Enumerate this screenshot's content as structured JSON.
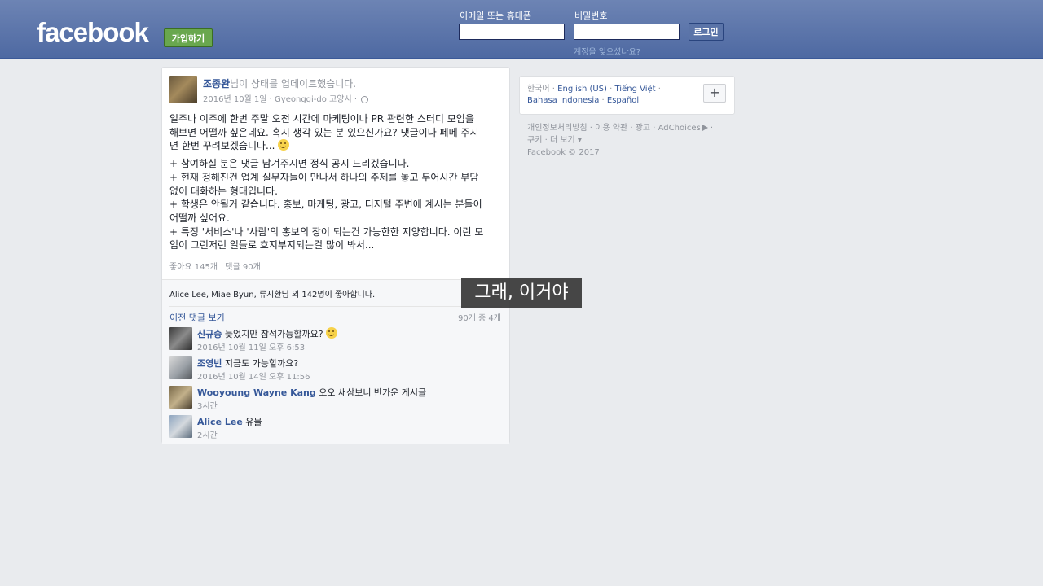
{
  "header": {
    "logo": "facebook",
    "signup_label": "가입하기",
    "email_label": "이메일 또는 휴대폰",
    "password_label": "비밀번호",
    "email_value": "",
    "password_value": "",
    "login_label": "로그인",
    "forgot_label": "계정을 잊으셨나요?"
  },
  "post": {
    "author": "조종완",
    "action": "님이 상태를 업데이트했습니다.",
    "date": "2016년 10월 1일",
    "location": "Gyeonggi-do 고양시",
    "paragraph1": "일주나 이주에 한번 주말 오전 시간에 마케팅이나 PR 관련한 스터디 모임을\n해보면 어떨까 싶은데요. 혹시 생각 있는 분 있으신가요? 댓글이나 페메 주시\n면 한번 꾸려보겠습니다...",
    "paragraph2": "+ 참여하실 분은 댓글 남겨주시면 정식 공지 드리겠습니다.\n+ 현재 정해진건 업계 실무자들이 만나서 하나의 주제를 놓고 두어시간 부담\n없이 대화하는 형태입니다.\n+ 학생은 안될거 같습니다. 홍보, 마케팅, 광고, 디지털 주변에 계시는 분들이\n어떨까 싶어요.\n+ 특정 '서비스'나 '사람'의 홍보의 장이 되는건 가능한한 지양합니다. 이런 모\n임이 그런저런 일들로 흐지부지되는걸 많이 봐서...",
    "likes_count": "좋아요 145개",
    "comments_count": "댓글 90개",
    "likes_line": "Alice Lee, Miae Byun, 류지환님 외 142명이 좋아합니다.",
    "prev_comments": "이전 댓글 보기",
    "comment_range": "90개 중 4개",
    "comments": [
      {
        "name": "신규승",
        "text": "늦었지만 참석가능할까요?",
        "time": "2016년 10월 11일 오후 6:53"
      },
      {
        "name": "조영빈",
        "text": "지금도 가능할까요?",
        "time": "2016년 10월 14일 오후 11:56"
      },
      {
        "name": "Wooyoung Wayne Kang",
        "text": "오오 새삼보니 반가운 게시글",
        "time": "3시간"
      },
      {
        "name": "Alice Lee",
        "text": "유물",
        "time": "2시간"
      }
    ]
  },
  "caption": "그래, 이거야",
  "sidebar": {
    "languages": [
      "한국어",
      "English (US)",
      "Tiếng Việt",
      "Bahasa Indonesia",
      "Español"
    ],
    "plus_label": "+",
    "footer": [
      "개인정보처리방침",
      "이용 약관",
      "광고",
      "AdChoices",
      "쿠키",
      "더 보기"
    ],
    "copyright": "Facebook © 2017"
  }
}
